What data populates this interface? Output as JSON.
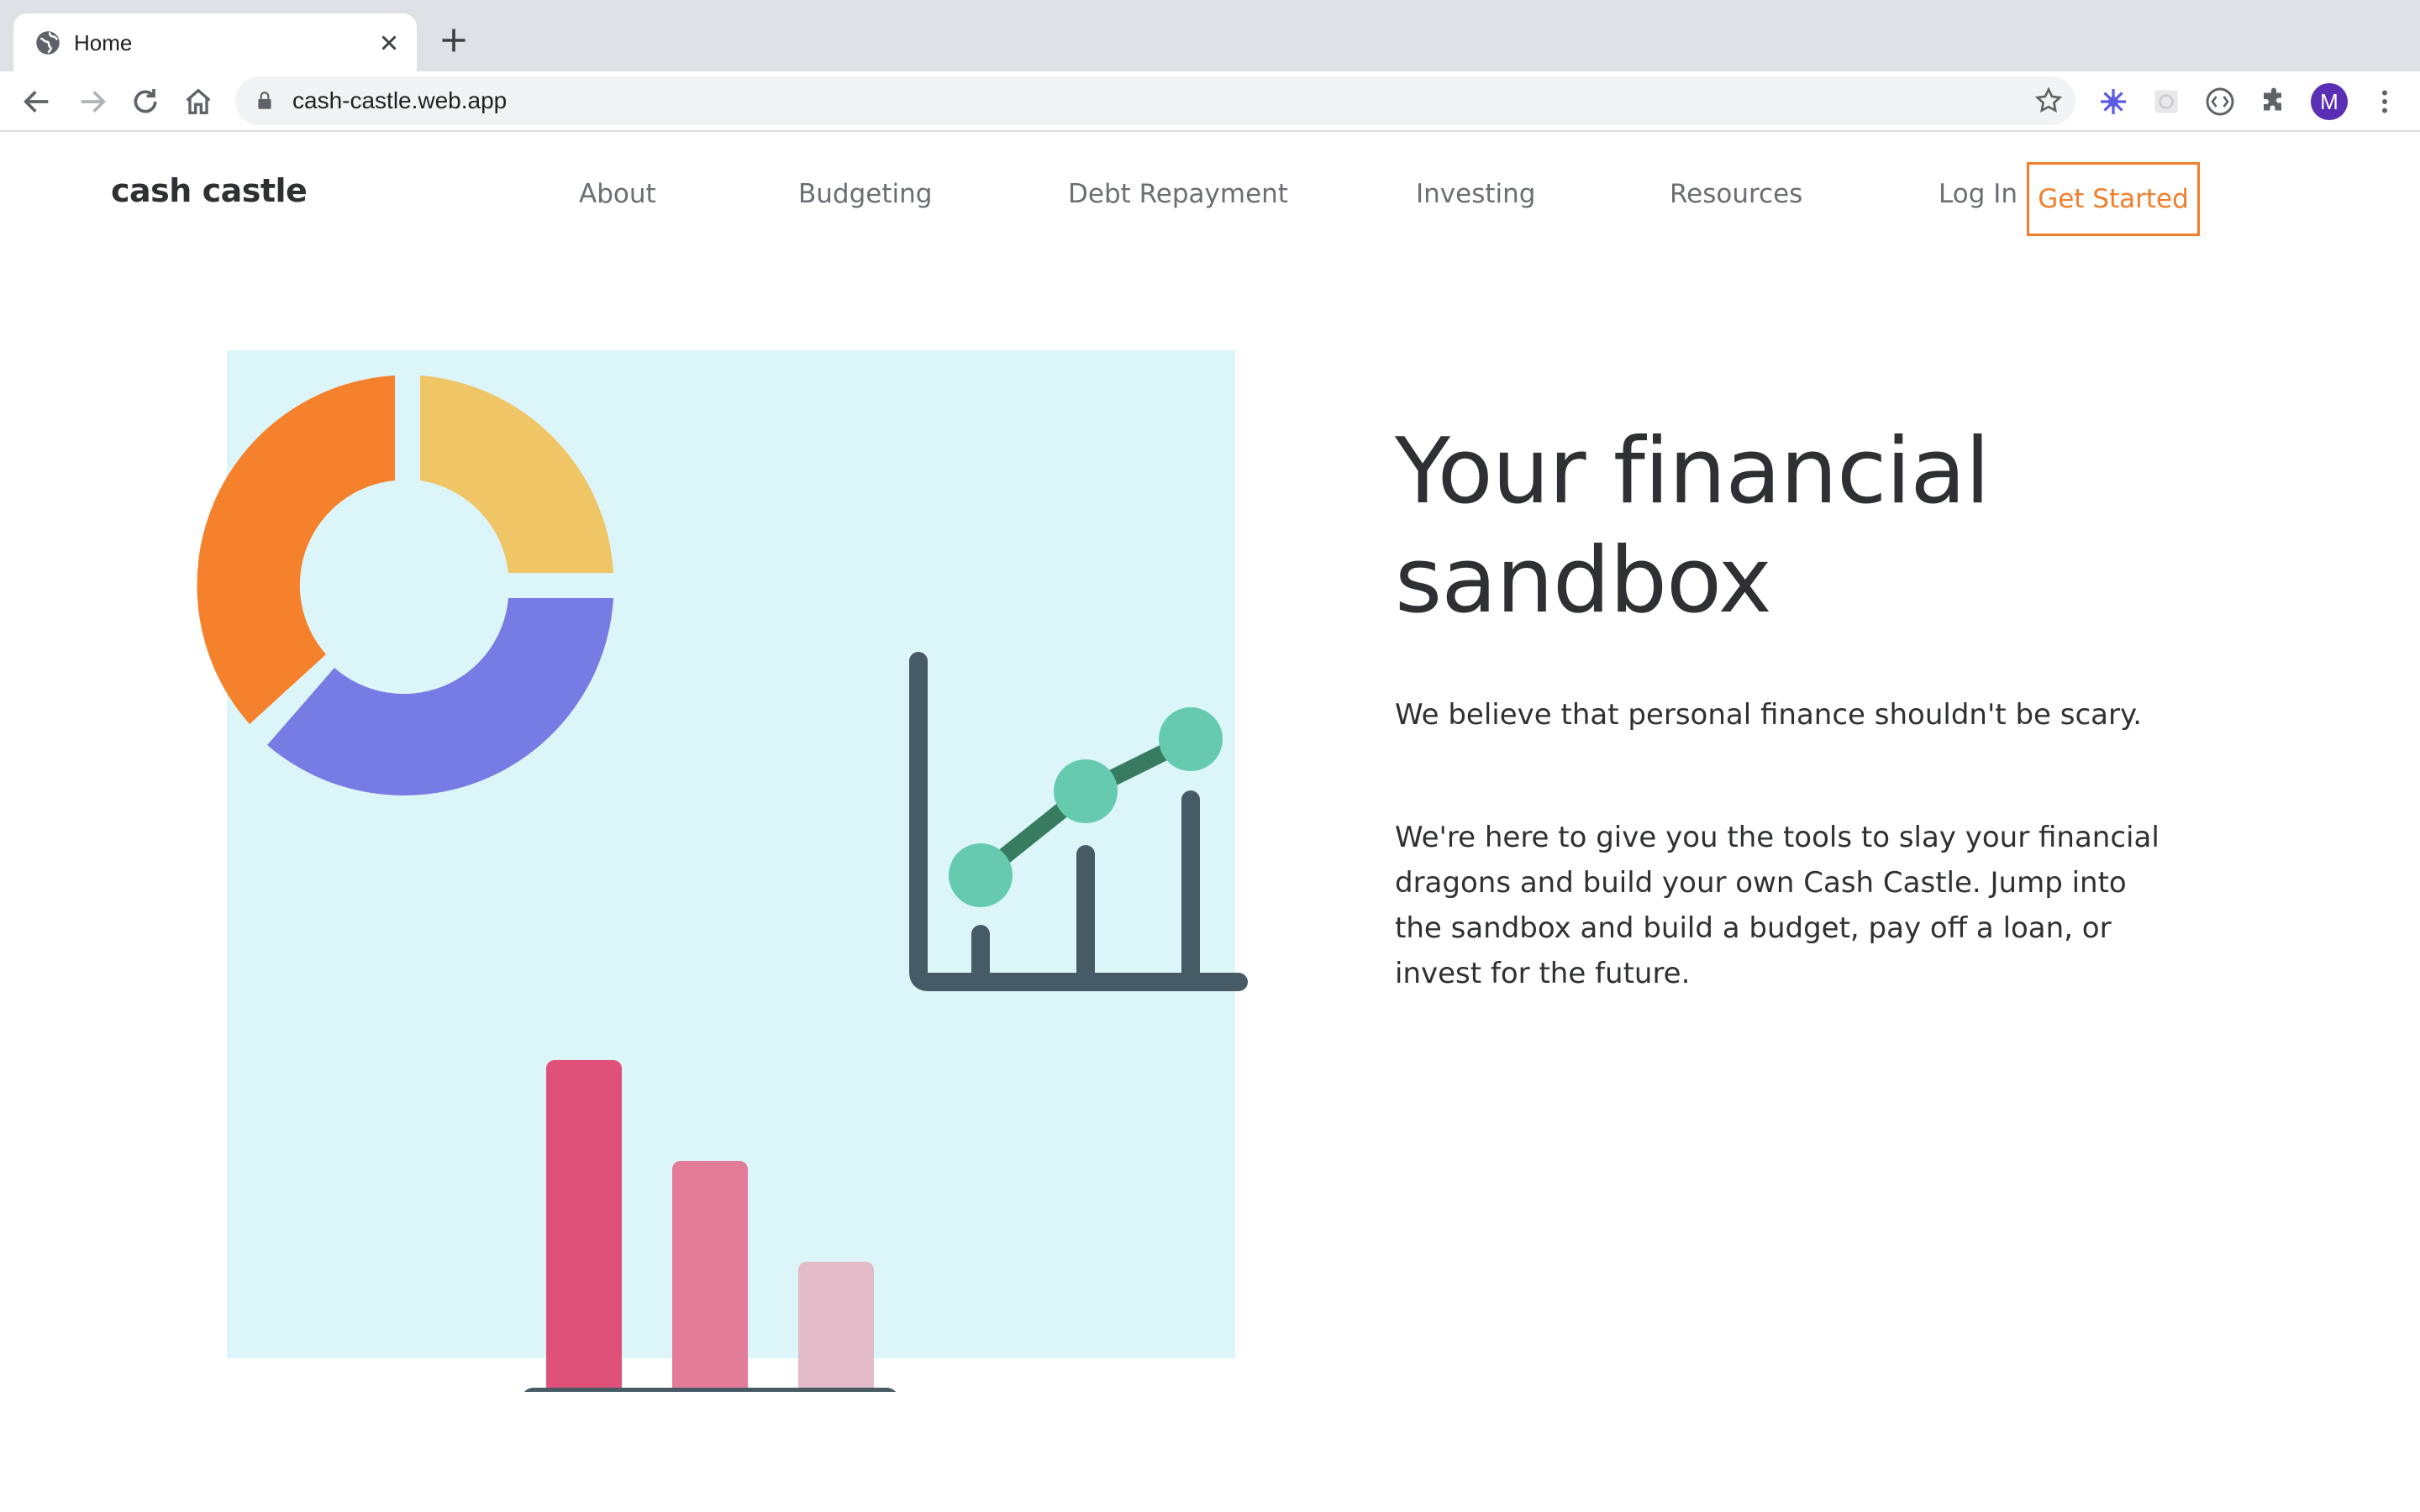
{
  "browser": {
    "tab_title": "Home",
    "url": "cash-castle.web.app",
    "profile_initial": "M",
    "avatar_color": "#5b2fb3"
  },
  "site": {
    "logo": "cash castle",
    "nav": [
      {
        "label": "About"
      },
      {
        "label": "Budgeting"
      },
      {
        "label": "Debt Repayment"
      },
      {
        "label": "Investing"
      },
      {
        "label": "Resources"
      },
      {
        "label": "Log In"
      }
    ],
    "cta_label": "Get Started",
    "accent_color": "#f17e2c"
  },
  "hero": {
    "title": "Your financial sandbox",
    "paragraph_1": "We believe that personal finance shouldn't be scary.",
    "paragraph_2": "We're here to give you the tools to slay your financial dragons and build your own Cash Castle. Jump into the sandbox and build a budget, pay off a loan, or invest for the future."
  },
  "illustration": {
    "background_color": "#dcf5f9",
    "donut_colors": [
      "#f5812c",
      "#f0c566",
      "#777be4"
    ],
    "bar_colors": [
      "#df5178",
      "#e27c98",
      "#e4bbc8"
    ],
    "line_chart_color": "#66cbae",
    "axis_color": "#465b65"
  }
}
